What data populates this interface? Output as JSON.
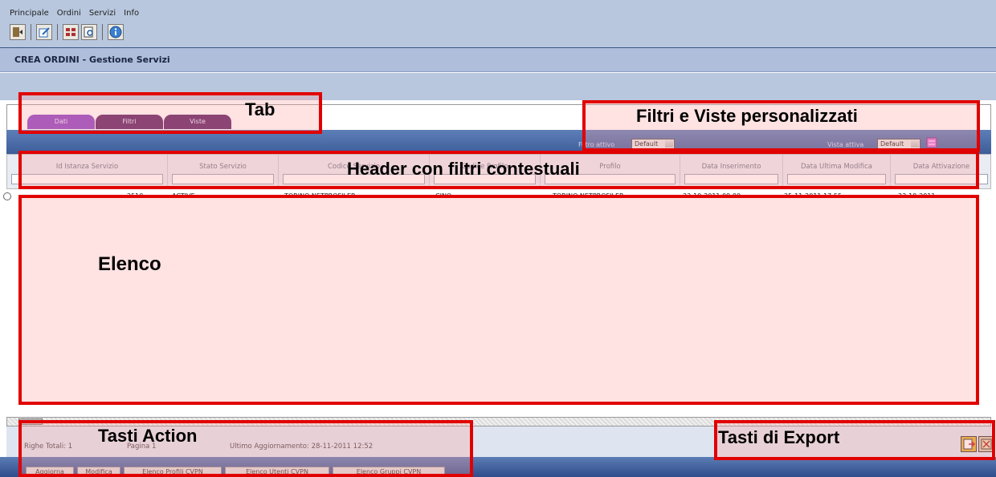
{
  "menu": {
    "items": [
      "Principale",
      "Ordini",
      "Servizi",
      "Info"
    ]
  },
  "toolbar": {
    "icons": [
      "exit-icon",
      "edit-icon",
      "grid-icon",
      "search-icon",
      "info-icon"
    ]
  },
  "app": {
    "title": "CREA ORDINI - Gestione Servizi"
  },
  "tabs": [
    {
      "label": "Dati",
      "active": true,
      "color": "#8a3fc4"
    },
    {
      "label": "Filtri",
      "active": false,
      "color": "#5a1d60"
    },
    {
      "label": "Viste",
      "active": false,
      "color": "#5a1d60"
    }
  ],
  "filters": {
    "filter_label": "Filtro attivo",
    "filter_value": "Default",
    "view_label": "Vista attiva",
    "view_value": "Default"
  },
  "table": {
    "columns": [
      "Id Istanza Servizio",
      "Stato Servizio",
      "Codice Servizio",
      "Codice Profilo",
      "Profilo",
      "Data Inserimento",
      "Data Ultima Modifica",
      "Data Attivazione"
    ],
    "rows": [
      [
        "2510",
        "ACTIVE",
        "TORINO NETPROFILER",
        "CINO",
        "TORINO NETPROFILER",
        "23-10-2011 09:00",
        "25-11-2011 17:55",
        "23-10-2011"
      ]
    ]
  },
  "status": {
    "total": "Righe Totali: 1",
    "page": "Pagina 1",
    "updated": "Ultimo Aggiornamento: 28-11-2011 12:52"
  },
  "actions": [
    "Aggiorna",
    "Modifica",
    "Elenco Profili CVPN",
    "Elenco Utenti CVPN",
    "Elenco Gruppi CVPN"
  ],
  "export": {
    "icons": [
      "export-excel-icon",
      "export-close-icon"
    ]
  },
  "callouts": {
    "tab": "Tab",
    "filters_views": "Filtri e Viste personalizzati",
    "header": "Header con filtri contestuali",
    "list": "Elenco",
    "actions": "Tasti Action",
    "export": "Tasti di Export"
  },
  "colors": {
    "callout": "#e10000",
    "header_bar": "#3d5c99",
    "tab_active": "#8a3fc4",
    "tab_inactive": "#5a1d60"
  }
}
